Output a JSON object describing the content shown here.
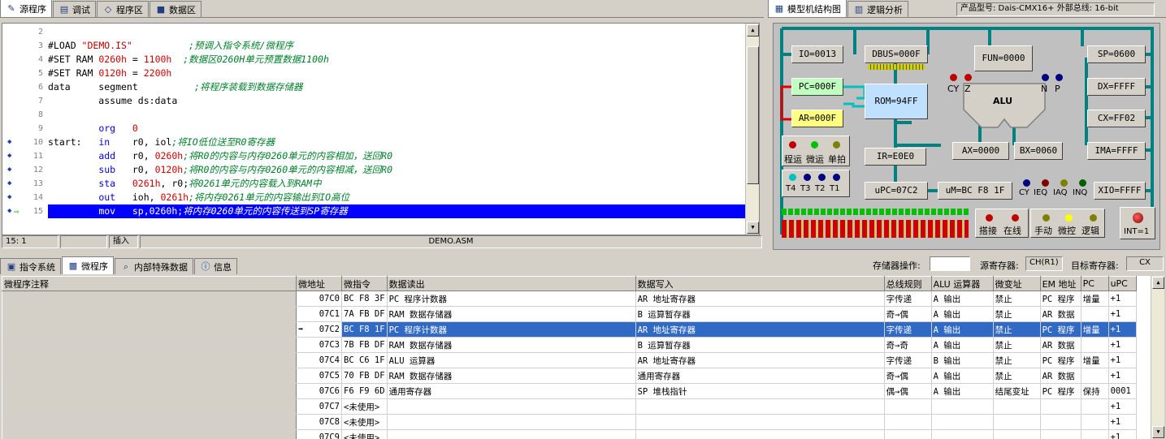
{
  "left_tabs": [
    {
      "label": "源程序",
      "icon": "source-icon",
      "active": true
    },
    {
      "label": "调试",
      "icon": "debug-icon"
    },
    {
      "label": "程序区",
      "icon": "program-area-icon"
    },
    {
      "label": "数据区",
      "icon": "data-area-icon"
    }
  ],
  "right_tabs": [
    {
      "label": "模型机结构图",
      "icon": "model-diagram-icon",
      "active": true
    },
    {
      "label": "逻辑分析",
      "icon": "logic-analyzer-icon"
    }
  ],
  "product": {
    "label": "产品型号: Dais-CMX16+  外部总线: 16-bit"
  },
  "editor": {
    "lines": [
      {
        "n": "2",
        "code": []
      },
      {
        "n": "3",
        "code": [
          [
            "#LOAD ",
            ""
          ],
          [
            "\"DEMO.IS\"",
            "str"
          ],
          [
            "          ",
            ""
          ],
          [
            ";预调入指令系统/微程序",
            "cm"
          ]
        ]
      },
      {
        "n": "4",
        "code": [
          [
            "#SET RAM ",
            ""
          ],
          [
            "0260h",
            "num"
          ],
          [
            " = ",
            ""
          ],
          [
            "1100h",
            "num"
          ],
          [
            "  ",
            ""
          ],
          [
            ";数据区0260H单元预置数据1100h",
            "cm"
          ]
        ]
      },
      {
        "n": "5",
        "code": [
          [
            "#SET RAM ",
            ""
          ],
          [
            "0120h",
            "num"
          ],
          [
            " = ",
            ""
          ],
          [
            "2200h",
            "num"
          ]
        ]
      },
      {
        "n": "6",
        "code": [
          [
            "data     segment          ",
            ""
          ],
          [
            ";将程序装载到数据存储器",
            "cm"
          ]
        ]
      },
      {
        "n": "7",
        "code": [
          [
            "         assume ds:data",
            ""
          ]
        ]
      },
      {
        "n": "8",
        "code": []
      },
      {
        "n": "9",
        "code": [
          [
            "         ",
            ""
          ],
          [
            "org",
            "kw"
          ],
          [
            "   ",
            ""
          ],
          [
            "0",
            "num"
          ]
        ]
      },
      {
        "n": "10",
        "bp": true,
        "code": [
          [
            "start:   ",
            ""
          ],
          [
            "in",
            "kw"
          ],
          [
            "    r0, iol",
            ""
          ],
          [
            ";将IO低位送至R0寄存器",
            "cm"
          ]
        ]
      },
      {
        "n": "11",
        "bp": true,
        "code": [
          [
            "         ",
            ""
          ],
          [
            "add",
            "kw"
          ],
          [
            "   r0, ",
            ""
          ],
          [
            "0260h",
            "num"
          ],
          [
            ";将R0的内容与内存0260单元的内容相加，送回R0",
            "cm"
          ]
        ]
      },
      {
        "n": "12",
        "bp": true,
        "code": [
          [
            "         ",
            ""
          ],
          [
            "sub",
            "kw"
          ],
          [
            "   r0, ",
            ""
          ],
          [
            "0120h",
            "num"
          ],
          [
            ";将R0的内容与内存0260单元的内容相减，送回R0",
            "cm"
          ]
        ]
      },
      {
        "n": "13",
        "bp": true,
        "code": [
          [
            "         ",
            ""
          ],
          [
            "sta",
            "kw"
          ],
          [
            "   ",
            ""
          ],
          [
            "0261h",
            "num"
          ],
          [
            ", r0;",
            ""
          ],
          [
            "将0261单元的内容载入到RAM中",
            "cm"
          ]
        ]
      },
      {
        "n": "14",
        "bp": true,
        "code": [
          [
            "         ",
            ""
          ],
          [
            "out",
            "kw"
          ],
          [
            "   ioh, ",
            ""
          ],
          [
            "0261h",
            "num"
          ],
          [
            ";将内存0261单元的内容输出到IO高位",
            "cm"
          ]
        ]
      },
      {
        "n": "15",
        "bp": true,
        "current": true,
        "code": [
          [
            "         ",
            ""
          ],
          [
            "mov",
            "kw"
          ],
          [
            "   sp,0260h;",
            ""
          ],
          [
            "将内存0260单元的内容传送到SP寄存器",
            "cm"
          ]
        ]
      }
    ]
  },
  "status": {
    "pos": "15:   1",
    "mode": "插入",
    "file": "DEMO.ASM"
  },
  "machine": {
    "regs": {
      "io": "IO=0013",
      "dbus": "DBUS=000F",
      "fun": "FUN=0000",
      "sp": "SP=0600",
      "pc": "PC=000F",
      "rom": "ROM=94FF",
      "dx": "DX=FFFF",
      "ar": "AR=000F",
      "alu": "ALU",
      "cx": "CX=FF02",
      "ir": "IR=E0E0",
      "ax": "AX=0000",
      "bx": "BX=0060",
      "ima": "IMA=FFFF",
      "upc": "uPC=07C2",
      "um": "uM=BC F8 1F",
      "xio": "XIO=FFFF"
    },
    "flags": {
      "cy": "CY",
      "z": "Z",
      "n": "N",
      "p": "P"
    },
    "run": [
      "程运",
      "微运",
      "单拍"
    ],
    "timing": [
      "T4",
      "T3",
      "T2",
      "T1"
    ],
    "irq": [
      "CY",
      "IEQ",
      "IAQ",
      "INQ"
    ],
    "switches": [
      "搭接",
      "在线",
      "手动",
      "微控",
      "逻辑"
    ],
    "int": "INT=1",
    "colors": {
      "bus": "#008080",
      "pc": "#c0ffc0",
      "ar": "#ffff80",
      "rom": "#c0e0ff",
      "red": "#e00000",
      "cyan": "#00c0c0"
    }
  },
  "bottom_tabs": [
    {
      "label": "指令系统",
      "icon": "instruction-set-icon"
    },
    {
      "label": "微程序",
      "icon": "microprogram-icon",
      "active": true
    },
    {
      "label": "内部特殊数据",
      "icon": "special-data-icon"
    },
    {
      "label": "信息",
      "icon": "info-icon"
    }
  ],
  "mem_ops": {
    "label": "存储器操作:",
    "value": "",
    "src_label": "源寄存器:",
    "src_value": "CH(R1)",
    "dst_label": "目标寄存器:",
    "dst_value": "CX"
  },
  "micro": {
    "headers": [
      "微程序注释",
      "微地址",
      "微指令",
      "数据读出",
      "数据写入",
      "总线规则",
      "ALU 运算器",
      "微变址",
      "EM 地址",
      "PC",
      "uPC"
    ],
    "rows": [
      [
        "",
        "07C0",
        "BC F8 3F",
        "PC 程序计数器",
        "AR 地址寄存器",
        "字传递",
        "A 输出",
        "禁止",
        "PC 程序",
        "增量",
        "+1"
      ],
      [
        "",
        "07C1",
        "7A FB DF",
        "RAM 数据存储器",
        "B 运算暂存器",
        "奇→偶",
        "A 输出",
        "禁止",
        "AR 数据",
        "",
        "+1"
      ],
      [
        "",
        "07C2",
        "BC F8 1F",
        "PC 程序计数器",
        "AR 地址寄存器",
        "字传递",
        "A 输出",
        "禁止",
        "PC 程序",
        "增量",
        "+1"
      ],
      [
        "",
        "07C3",
        "7B FB DF",
        "RAM 数据存储器",
        "B 运算暂存器",
        "奇→奇",
        "A 输出",
        "禁止",
        "AR 数据",
        "",
        "+1"
      ],
      [
        "",
        "07C4",
        "BC C6 1F",
        "ALU 运算器",
        "AR 地址寄存器",
        "字传递",
        "B 输出",
        "禁止",
        "PC 程序",
        "增量",
        "+1"
      ],
      [
        "",
        "07C5",
        "70 FB DF",
        "RAM 数据存储器",
        "通用寄存器",
        "奇→偶",
        "A 输出",
        "禁止",
        "AR 数据",
        "",
        "+1"
      ],
      [
        "",
        "07C6",
        "F6 F9 6D",
        "通用寄存器",
        "SP 堆栈指针",
        "偶→偶",
        "A 输出",
        "结尾变址",
        "PC 程序",
        "保持",
        "0001"
      ],
      [
        "",
        "07C7",
        "<未使用>",
        "",
        "",
        "",
        "",
        "",
        "",
        "",
        "+1"
      ],
      [
        "",
        "07C8",
        "<未使用>",
        "",
        "",
        "",
        "",
        "",
        "",
        "",
        "+1"
      ],
      [
        "",
        "07C9",
        "<未使用>",
        "",
        "",
        "",
        "",
        "",
        "",
        "",
        "+1"
      ]
    ]
  }
}
